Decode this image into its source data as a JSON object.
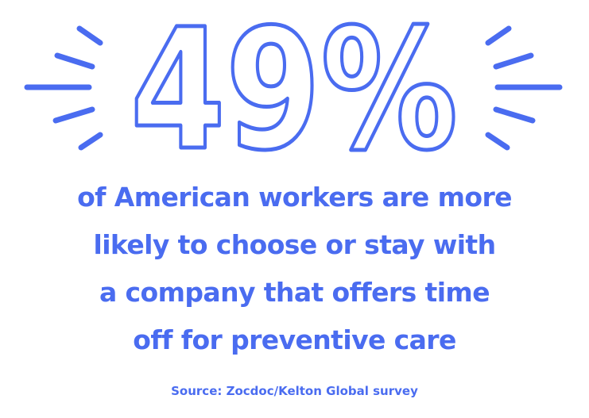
{
  "colors": {
    "accent": "#4a6cf0"
  },
  "headline": {
    "value": "49%"
  },
  "caption": {
    "lines": [
      "of American workers are more",
      "likely to choose or stay with",
      "a company that offers time",
      "off for preventive care"
    ]
  },
  "source": {
    "text": "Source: Zocdoc/Kelton Global survey"
  }
}
